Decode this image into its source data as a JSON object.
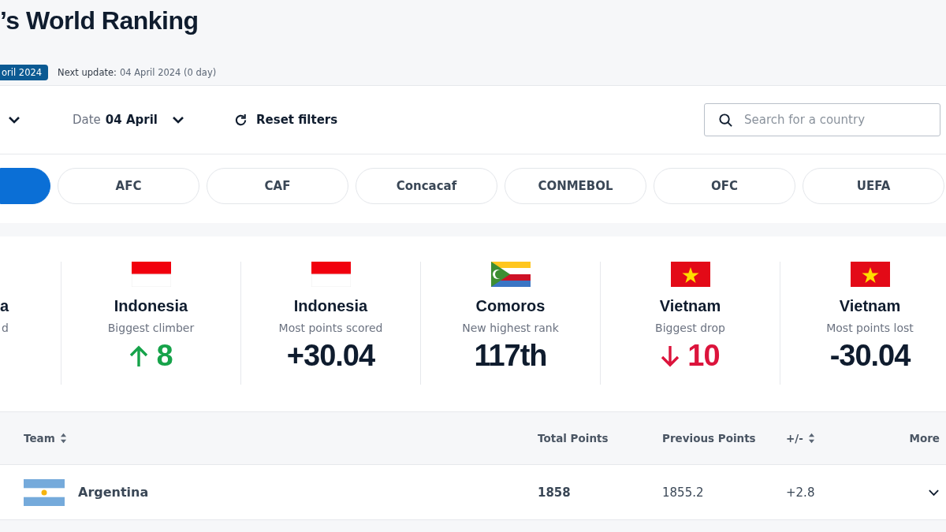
{
  "title": "’s World Ranking",
  "update": {
    "badge": "oril 2024",
    "next_label": "Next update:",
    "next_value": "04 April 2024 (0 day)"
  },
  "filters": {
    "date_label": "Date",
    "date_value": "04 April",
    "reset": "Reset filters",
    "search_placeholder": "Search for a country"
  },
  "confederations": [
    {
      "selected": true
    },
    {
      "label": "AFC",
      "selected": false
    },
    {
      "label": "CAF",
      "selected": false
    },
    {
      "label": "Concacaf",
      "selected": false
    },
    {
      "label": "CONMEBOL",
      "selected": false
    },
    {
      "label": "OFC",
      "selected": false
    },
    {
      "label": "UEFA",
      "selected": false
    }
  ],
  "highlights": [
    {
      "kind": "cut",
      "name": "a",
      "caption": "d"
    },
    {
      "kind": "indonesia",
      "name": "Indonesia",
      "caption": "Biggest climber",
      "figure": {
        "kind": "rise",
        "text": "8"
      }
    },
    {
      "kind": "indonesia",
      "name": "Indonesia",
      "caption": "Most points scored",
      "figure": {
        "kind": "plain",
        "text": "+30.04"
      }
    },
    {
      "kind": "comoros",
      "name": "Comoros",
      "caption": "New highest rank",
      "figure": {
        "kind": "plain",
        "text": "117th"
      }
    },
    {
      "kind": "vietnam",
      "name": "Vietnam",
      "caption": "Biggest drop",
      "figure": {
        "kind": "drop",
        "text": "10"
      }
    },
    {
      "kind": "vietnam",
      "name": "Vietnam",
      "caption": "Most points lost",
      "figure": {
        "kind": "plain",
        "text": "-30.04"
      }
    }
  ],
  "table": {
    "columns": [
      {
        "label": "Team",
        "sortable": true
      },
      {
        "label": "Total Points",
        "sortable": false
      },
      {
        "label": "Previous Points",
        "sortable": false
      },
      {
        "label": "+/-",
        "sortable": true
      },
      {
        "label": "More",
        "sortable": false
      }
    ],
    "rows": [
      {
        "kind": "argentina",
        "team": "Argentina",
        "total": "1858",
        "previous": "1855.2",
        "change": "+2.8"
      }
    ]
  }
}
